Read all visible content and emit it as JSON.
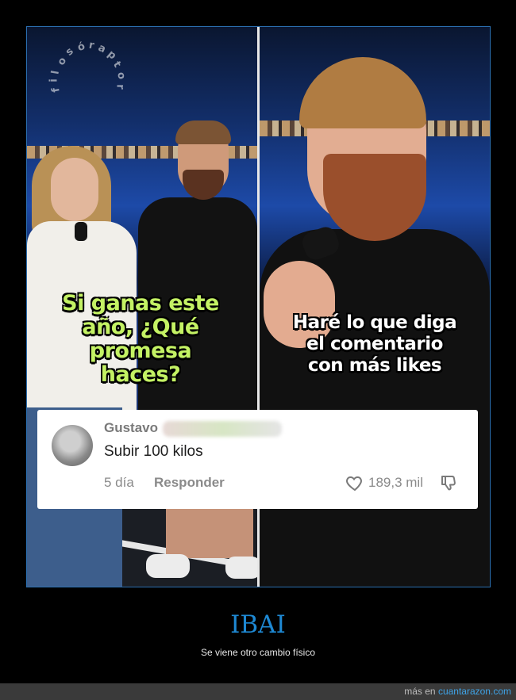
{
  "watermark": {
    "text": "filosórapto r"
  },
  "left_panel": {
    "caption": [
      "Si ganas este",
      "año, ¿Qué",
      "promesa",
      "haces?"
    ]
  },
  "right_panel": {
    "caption": [
      "Haré lo que diga",
      "el comentario",
      "con más likes"
    ]
  },
  "comment": {
    "username": "Gustavo",
    "text": "Subir 100 kilos",
    "time": "5 día",
    "reply_label": "Responder",
    "like_count": "189,3 mil"
  },
  "post": {
    "title": "IBAI",
    "subtitle": "Se viene otro cambio físico"
  },
  "footer": {
    "prefix": "más en",
    "site": "cuantarazon.com"
  },
  "colors": {
    "caption_green": "#c4f264",
    "title_blue": "#1e88d2",
    "link_blue": "#3fa3e6",
    "frame_border": "#2b6fb0"
  }
}
